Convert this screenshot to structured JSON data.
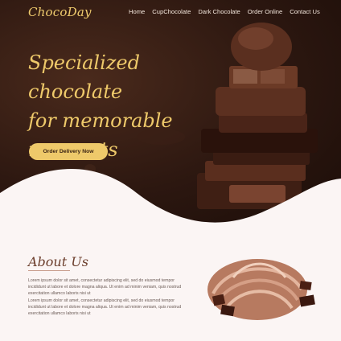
{
  "brand": {
    "logo": "ChocoDay"
  },
  "nav": {
    "items": [
      {
        "label": "Home"
      },
      {
        "label": "CupChocolate"
      },
      {
        "label": "Dark Chocolate"
      },
      {
        "label": "Order Online"
      },
      {
        "label": "Contact Us"
      }
    ]
  },
  "hero": {
    "headline_line1": "Specialized chocolate",
    "headline_line2": "for memorable",
    "headline_line3": "moments",
    "cta_label": "Order Delivery Now"
  },
  "about": {
    "title": "About Us",
    "paragraph1": "Lorem ipsum dolor sit amet, consectetur adipiscing elit, sed do eiusmod tempor incididunt ut labore et dolore magna aliqua. Ut enim ad minim veniam, quis nostrud exercitation ullamco laboris nisi ut",
    "paragraph2": "Lorem ipsum dolor sit amet, consectetur adipiscing elit, sed do eiusmod tempor incididunt ut labore et dolore magna aliqua. Ut enim ad minim veniam, quis nostrud exercitation ullamco laboris nisi ut"
  },
  "colors": {
    "accent_gold": "#eec96a",
    "hero_dark": "#2c1710",
    "page_bg": "#fbf5f4",
    "about_title": "#6b3d2b"
  }
}
